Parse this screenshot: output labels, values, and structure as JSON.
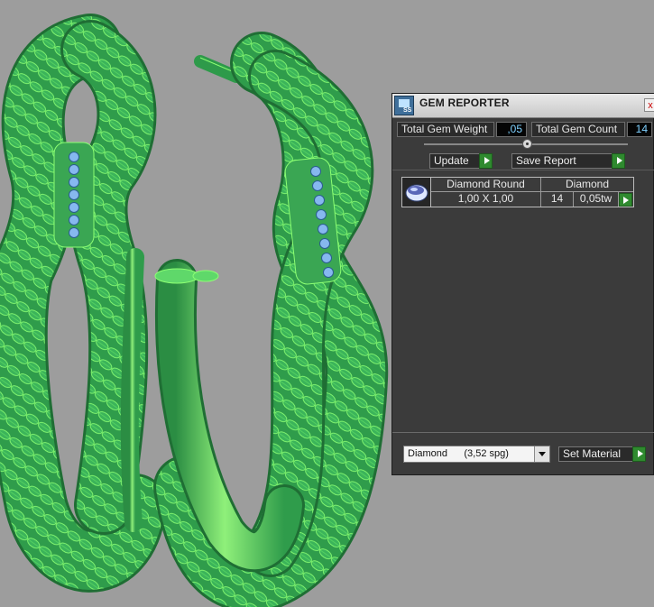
{
  "panel": {
    "title": "GEM REPORTER",
    "app_icon_label": "SS",
    "close_label": "x",
    "total_weight_label": "Total Gem Weight",
    "total_weight_value": ",05",
    "total_count_label": "Total Gem Count",
    "total_count_value": "14",
    "update_label": "Update",
    "save_report_label": "Save Report",
    "gem_row": {
      "shape": "Diamond Round",
      "size": "1,00 X 1,00",
      "material": "Diamond",
      "count": "14",
      "weight": "0,05tw"
    },
    "material_select_value": "Diamond      (3,52 spg)",
    "set_material_label": "Set Material"
  },
  "colors": {
    "model_green": "#2e9a4a",
    "wire_green": "#7dff6a",
    "gem_blue": "#86b8ef",
    "value_cyan": "#7fd1ff",
    "go_green": "#2f8a2f"
  },
  "icons": [
    "close-icon",
    "play-arrow-icon",
    "dropdown-arrow-icon",
    "gem-thumbnail-icon",
    "gem-reporter-app-icon"
  ]
}
